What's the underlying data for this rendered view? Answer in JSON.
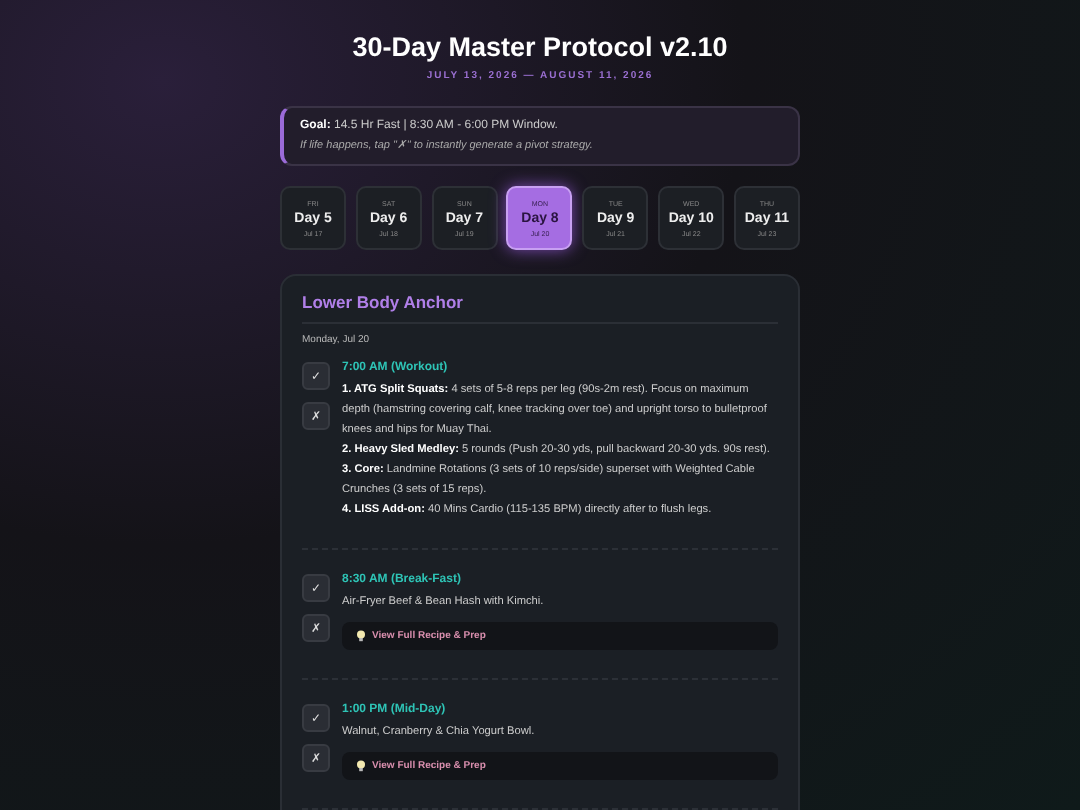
{
  "header": {
    "title": "30-Day Master Protocol v2.10",
    "dates": "JULY 13, 2026 — AUGUST 11, 2026"
  },
  "goal": {
    "line": "**Goal:** 14.5 Hr Fast | 8:30 AM - 6:00 PM Window.",
    "hint": "If life happens, tap \"✗\" to instantly generate a pivot strategy."
  },
  "days": [
    {
      "weekday": "FRI",
      "label": "Day 5",
      "date": "Jul 17",
      "selected": false
    },
    {
      "weekday": "SAT",
      "label": "Day 6",
      "date": "Jul 18",
      "selected": false
    },
    {
      "weekday": "SUN",
      "label": "Day 7",
      "date": "Jul 19",
      "selected": false
    },
    {
      "weekday": "MON",
      "label": "Day 8",
      "date": "Jul 20",
      "selected": true
    },
    {
      "weekday": "TUE",
      "label": "Day 9",
      "date": "Jul 21",
      "selected": false
    },
    {
      "weekday": "WED",
      "label": "Day 10",
      "date": "Jul 22",
      "selected": false
    },
    {
      "weekday": "THU",
      "label": "Day 11",
      "date": "Jul 23",
      "selected": false
    }
  ],
  "plan": {
    "title": "Lower Body Anchor",
    "date": "Monday, Jul 20",
    "entries": [
      {
        "time": "7:00 AM (Workout)",
        "done_label": "✓",
        "pivot_label": "✗",
        "lines": [
          "**1. ATG Split Squats:** 4 sets of 5-8 reps per leg (90s-2m rest). Focus on maximum depth (hamstring covering calf, knee tracking over toe) and upright torso to bulletproof knees and hips for Muay Thai.",
          "**2. Heavy Sled Medley:** 5 rounds (Push 20-30 yds, pull backward 20-30 yds. 90s rest).",
          "**3. Core:** Landmine Rotations (3 sets of 10 reps/side) superset with Weighted Cable Crunches (3 sets of 15 reps).",
          "**4. LISS Add-on:** 40 Mins Cardio (115-135 BPM) directly after to flush legs."
        ]
      },
      {
        "time": "8:30 AM (Break-Fast)",
        "done_label": "✓",
        "pivot_label": "✗",
        "lines": [
          "Air-Fryer Beef & Bean Hash with Kimchi."
        ],
        "recipe": "View Full Recipe & Prep"
      },
      {
        "time": "1:00 PM (Mid-Day)",
        "done_label": "✓",
        "pivot_label": "✗",
        "lines": [
          "Walnut, Cranberry & Chia Yogurt Bowl."
        ],
        "recipe": "View Full Recipe & Prep"
      }
    ]
  }
}
